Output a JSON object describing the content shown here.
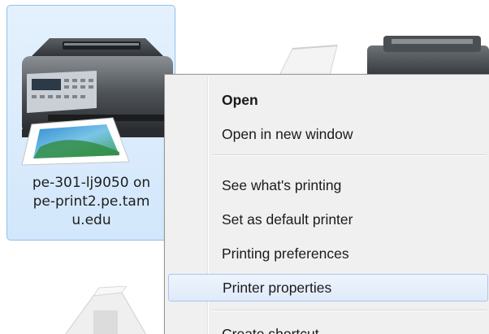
{
  "selected_printer": {
    "name_lines": [
      "pe-301-lj9050 on",
      "pe-print2.pe.tam",
      "u.edu"
    ],
    "icon": "multifunction-printer-icon"
  },
  "background_icons": [
    "printer-icon",
    "printer-icon",
    "printer-icon"
  ],
  "context_menu": {
    "items": [
      {
        "label": "Open",
        "bold": true
      },
      {
        "label": "Open in new window"
      },
      {
        "label": "See what's printing"
      },
      {
        "label": "Set as default printer"
      },
      {
        "label": "Printing preferences"
      },
      {
        "label": "Printer properties",
        "highlighted": true
      },
      {
        "label": "Create shortcut"
      }
    ]
  },
  "colors": {
    "selection_bg": "#d2e7fb",
    "selection_border": "#8ec1ea",
    "menu_bg": "#f0f0f0",
    "menu_highlight_border": "#a8c8ee"
  }
}
